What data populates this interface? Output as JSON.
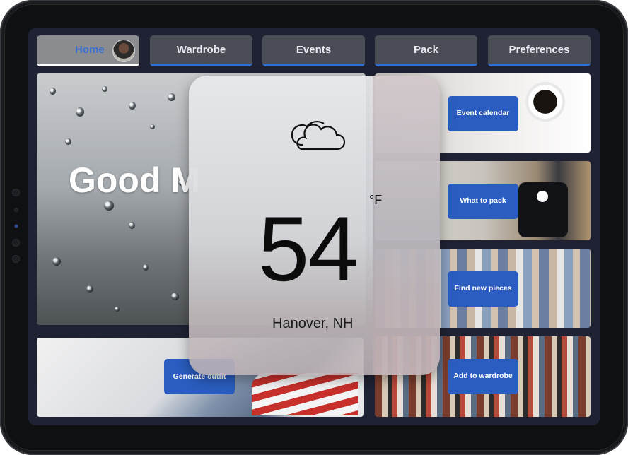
{
  "nav": {
    "tabs": [
      {
        "label": "Home",
        "active": true
      },
      {
        "label": "Wardrobe"
      },
      {
        "label": "Events"
      },
      {
        "label": "Pack"
      },
      {
        "label": "Preferences"
      }
    ]
  },
  "hero": {
    "greeting": "Good M"
  },
  "weather": {
    "icon": "cloud-icon",
    "temperature": "54",
    "unit": "°F",
    "location": "Hanover, NH"
  },
  "actions": {
    "event_calendar": "Event calendar",
    "what_to_pack": "What to pack",
    "find_new_pieces": "Find new pieces",
    "add_to_wardrobe": "Add to wardrobe",
    "generate_outfit": "Generate outfit"
  },
  "colors": {
    "accent": "#2a5dbf",
    "screen_bg": "#1f2233",
    "tab_bg": "#4a4c56"
  }
}
